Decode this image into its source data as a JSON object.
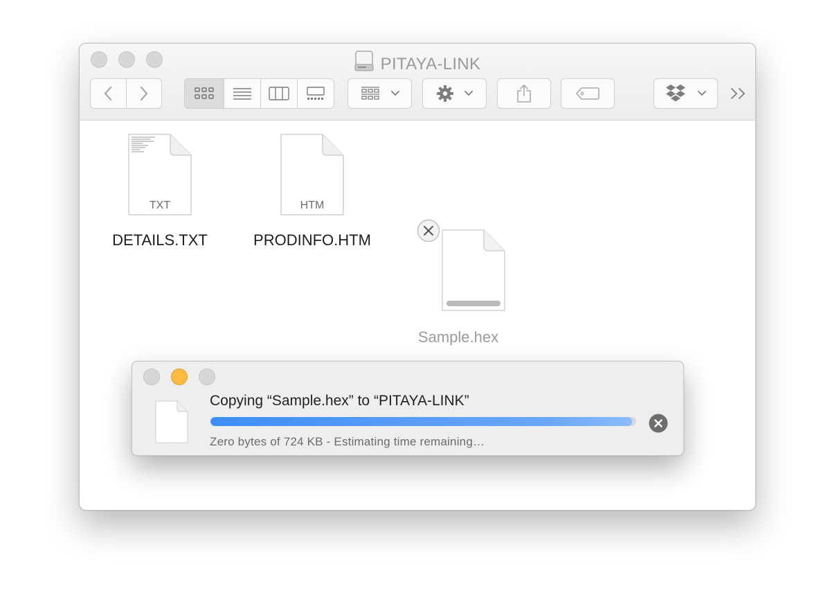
{
  "window": {
    "title": "PITAYA-LINK"
  },
  "toolbar": {
    "items": [
      "back",
      "forward",
      "icon-view",
      "list-view",
      "column-view",
      "gallery-view",
      "group",
      "action",
      "share",
      "tags",
      "dropbox",
      "more"
    ]
  },
  "files": [
    {
      "name": "DETAILS.TXT",
      "ext": "TXT"
    },
    {
      "name": "PRODINFO.HTM",
      "ext": "HTM"
    },
    {
      "name": "Sample.hex",
      "ext": "",
      "copying": true
    }
  ],
  "copy_dialog": {
    "title": "Copying “Sample.hex” to “PITAYA-LINK”",
    "status": "Zero bytes of 724 KB - Estimating time remaining…",
    "progress": 0.99
  },
  "colors": {
    "accent": "#3f8dfb",
    "minimize": "#fdbc40",
    "inactive_light": "#d7d7d7"
  }
}
